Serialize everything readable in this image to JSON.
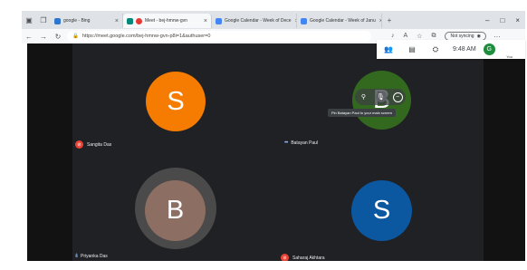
{
  "browser": {
    "tabs": [
      {
        "label": "google - Bing",
        "active": false
      },
      {
        "label": "Meet - bej-hmnw-gvn",
        "active": true
      },
      {
        "label": "Google Calendar - Week of Dece",
        "active": false
      },
      {
        "label": "Google Calendar - Week of Janu",
        "active": false
      }
    ],
    "new_tab": "+",
    "url": "https://meet.google.com/bej-hmnw-gvn-p8i=1&authuser=0",
    "sync_label": "Not syncing"
  },
  "meet": {
    "clock": "9:48 AM",
    "you_label": "You",
    "self_initial": "G",
    "participants": [
      {
        "name": "Sangita Das",
        "initial": "S",
        "color": "#f57c00",
        "muted": true
      },
      {
        "name": "Batayan Paul",
        "initial": "B",
        "color": "#33691e",
        "muted": false
      },
      {
        "name": "Priyanka Das",
        "initial": "B",
        "color": "#8d6e63",
        "muted": false
      },
      {
        "name": "Saharaj Akhtara",
        "initial": "S",
        "color": "#0b57a0",
        "muted": true
      }
    ],
    "tooltip": "Pin Batayan Paul to your main screen"
  }
}
